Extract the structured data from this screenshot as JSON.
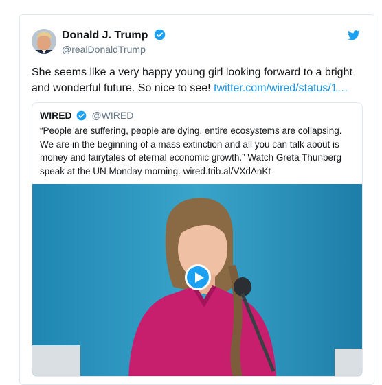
{
  "tweet": {
    "author_name": "Donald J. Trump",
    "author_handle": "@realDonaldTrump",
    "text": "She seems like a very happy young girl looking forward to a bright and wonderful future. So nice to see! ",
    "link_text": "twitter.com/wired/status/1…",
    "icons": [
      "avatar",
      "verified-badge-icon",
      "twitter-bird-icon"
    ]
  },
  "quoted_tweet": {
    "author_name": "WIRED",
    "author_handle": "@WIRED",
    "text": "“People are suffering, people are dying, entire ecosystems are collapsing. We are in the beginning of a mass extinction and all you can talk about is money and fairytales of eternal economic growth.” Watch Greta Thunberg speak at the UN Monday morning. wired.trib.al/VXdAnKt",
    "media": {
      "type": "video",
      "icon": "play-icon"
    }
  },
  "colors": {
    "link": "#1b95e0",
    "twitter_blue": "#1da1f2",
    "secondary_text": "#657786",
    "border": "#e1e8ed",
    "video_background": "#2a8fb6",
    "shirt": "#c81e6e"
  }
}
